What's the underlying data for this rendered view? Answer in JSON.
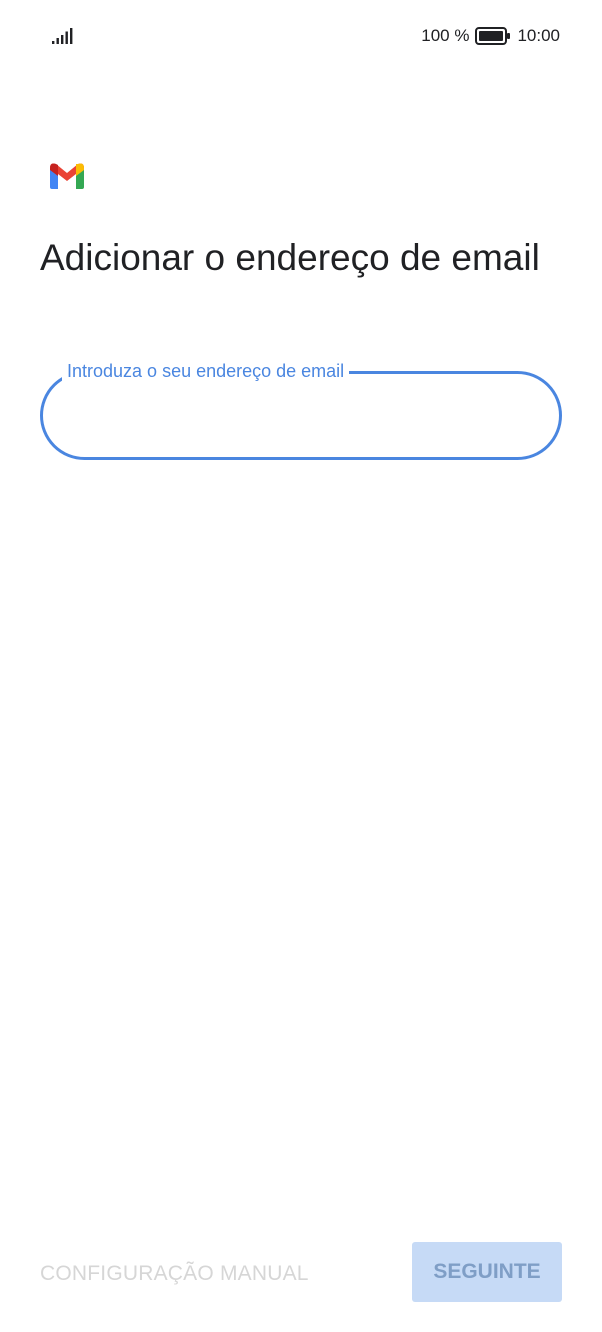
{
  "status_bar": {
    "signal_icon": "signal-icon",
    "battery_percent": "100 %",
    "battery_icon": "battery-icon",
    "time": "10:00"
  },
  "app": {
    "logo_icon": "gmail-logo-icon",
    "colors": {
      "accent": "#4a86e0",
      "gmail_red": "#ea4335",
      "gmail_blue": "#4285f4",
      "gmail_green": "#34a853",
      "gmail_yellow": "#fbbc04"
    }
  },
  "page": {
    "title": "Adicionar o endereço de email"
  },
  "email_input": {
    "label": "Introduza o seu endereço de email",
    "value": ""
  },
  "actions": {
    "manual_config_label": "CONFIGURAÇÃO MANUAL",
    "next_label": "SEGUINTE"
  }
}
